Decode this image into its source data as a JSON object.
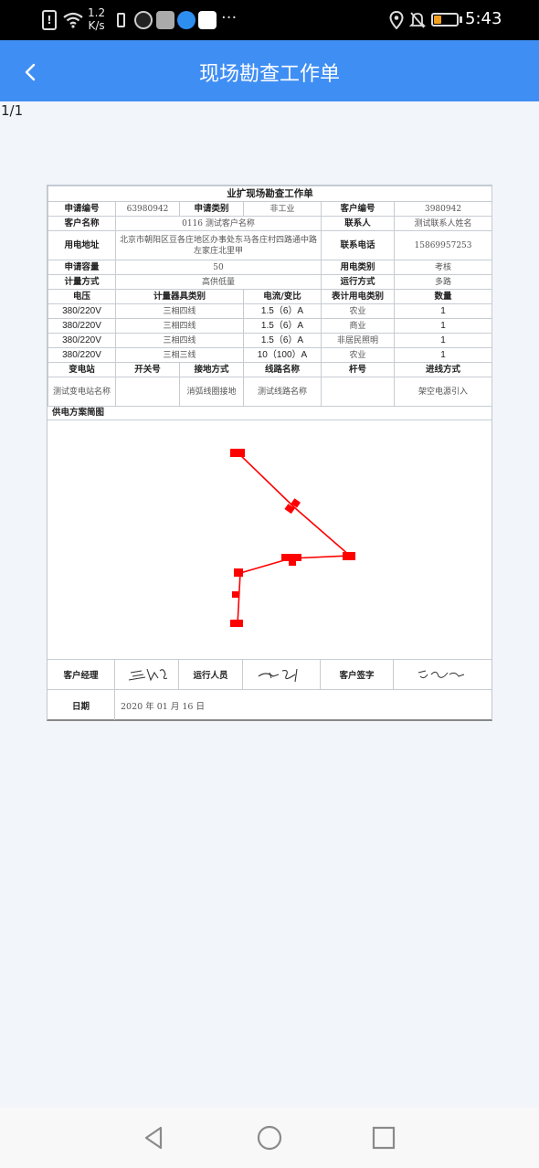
{
  "status_bar": {
    "net_speed_value": "1.2",
    "net_speed_unit": "K/s",
    "alert_glyph": "!",
    "overflow": "···",
    "time": "5:43",
    "battery_level": 0.35,
    "icons": [
      "alert-icon",
      "wifi-icon",
      "battery-saver-icon",
      "app-icon",
      "app-icon",
      "app-icon",
      "app-icon",
      "location-icon",
      "bell-muted-icon",
      "battery-icon"
    ]
  },
  "header": {
    "title": "现场勘查工作单",
    "back_icon": "chevron-left-icon",
    "color": "#3f8ef4"
  },
  "page_indicator": "1/1",
  "form": {
    "title": "业扩现场勘查工作单",
    "row1": {
      "label1": "申请编号",
      "value1": "63980942",
      "label2": "申请类别",
      "value2": "非工业",
      "label3": "客户编号",
      "value3": "3980942"
    },
    "row2": {
      "label1": "客户名称",
      "value1": "0116 测试客户名称",
      "label2": "联系人",
      "value2": "测试联系人姓名"
    },
    "row3": {
      "label1": "用电地址",
      "value1": "北京市朝阳区豆各庄地区办事处东马各庄村四路通中路左家庄北里甲",
      "label2": "联系电话",
      "value2": "15869957253"
    },
    "row4": {
      "label1": "申请容量",
      "value1": "50",
      "label2": "用电类别",
      "value2": "考核"
    },
    "row5": {
      "label1": "计量方式",
      "value1": "高供低量",
      "label2": "运行方式",
      "value2": "多路"
    },
    "meter_headers": [
      "电压",
      "计量器具类别",
      "电流/变比",
      "表计用电类别",
      "数量"
    ],
    "meter_rows": [
      [
        "380/220V",
        "三相四线",
        "1.5（6）A",
        "农业",
        "1"
      ],
      [
        "380/220V",
        "三相四线",
        "1.5（6）A",
        "商业",
        "1"
      ],
      [
        "380/220V",
        "三相四线",
        "1.5（6）A",
        "非居民照明",
        "1"
      ],
      [
        "380/220V",
        "三相三线",
        "10（100）A",
        "农业",
        "1"
      ]
    ],
    "line_headers": [
      "变电站",
      "开关号",
      "接地方式",
      "线路名称",
      "杆号",
      "进线方式"
    ],
    "line_row": [
      "测试变电站名称",
      "",
      "消弧线圈接地",
      "测试线路名称",
      "",
      "架空电源引入"
    ],
    "diagram_label": "供电方案简图",
    "diagram_color": "#ff0000",
    "signatures": {
      "manager_label": "客户经理",
      "operator_label": "运行人员",
      "customer_label": "客户签字"
    },
    "date_label": "日期",
    "date_value": "2020 年 01 月 16 日"
  },
  "nav_bar": {
    "back_icon": "triangle-back-icon",
    "home_icon": "circle-home-icon",
    "recents_icon": "square-recents-icon"
  }
}
